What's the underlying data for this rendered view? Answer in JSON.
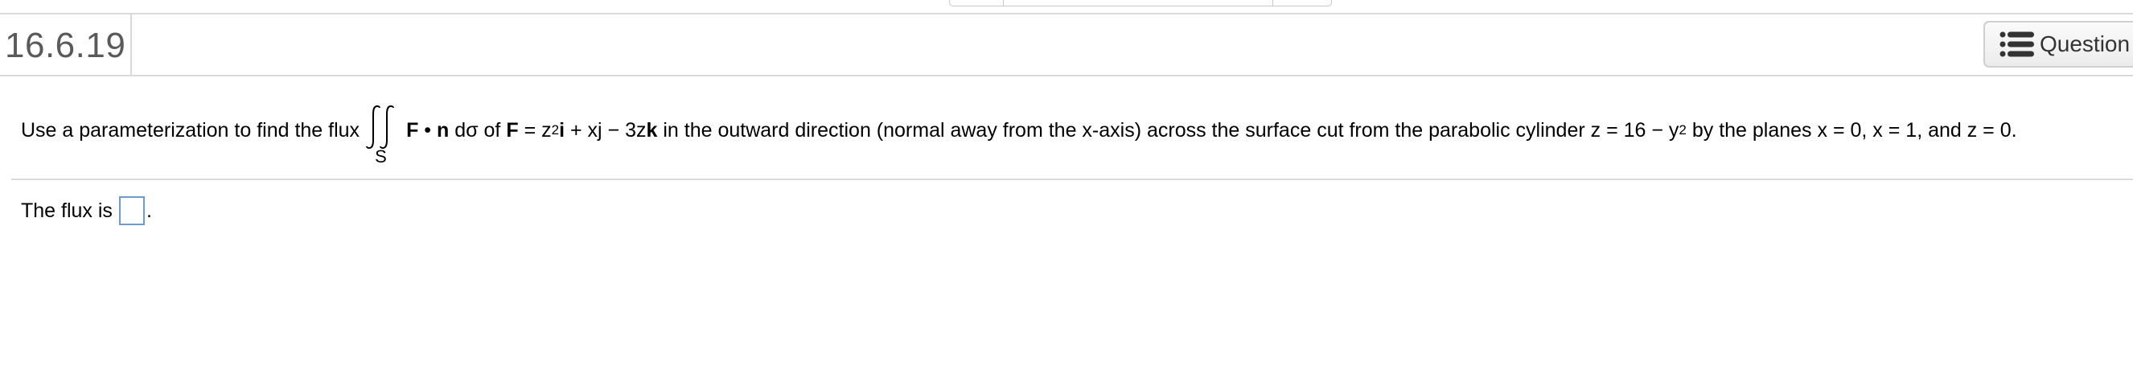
{
  "header": {
    "question_number": "16.6.19",
    "question_help_button_label": "Question",
    "question_help_icon": "list-icon"
  },
  "problem": {
    "lead_text": "Use a parameterization to find the flux",
    "integral_subscript": "S",
    "F": "F",
    "dot": "•",
    "n": "n",
    "d_sigma_of": "dσ of",
    "F2": "F",
    "eq_z": "= z",
    "exp_2": "2",
    "unit_i": "i",
    "plus_xj_minus_3z": "+ xj − 3z",
    "unit_k": "k",
    "description": "in the outward direction (normal away from the x-axis) across the surface cut from the parabolic cylinder z = 16 − y",
    "exp_2b": "2",
    "tail": "by the planes x = 0, x = 1, and z = 0."
  },
  "answer": {
    "prefix": "The flux is",
    "value": "",
    "suffix": "."
  }
}
